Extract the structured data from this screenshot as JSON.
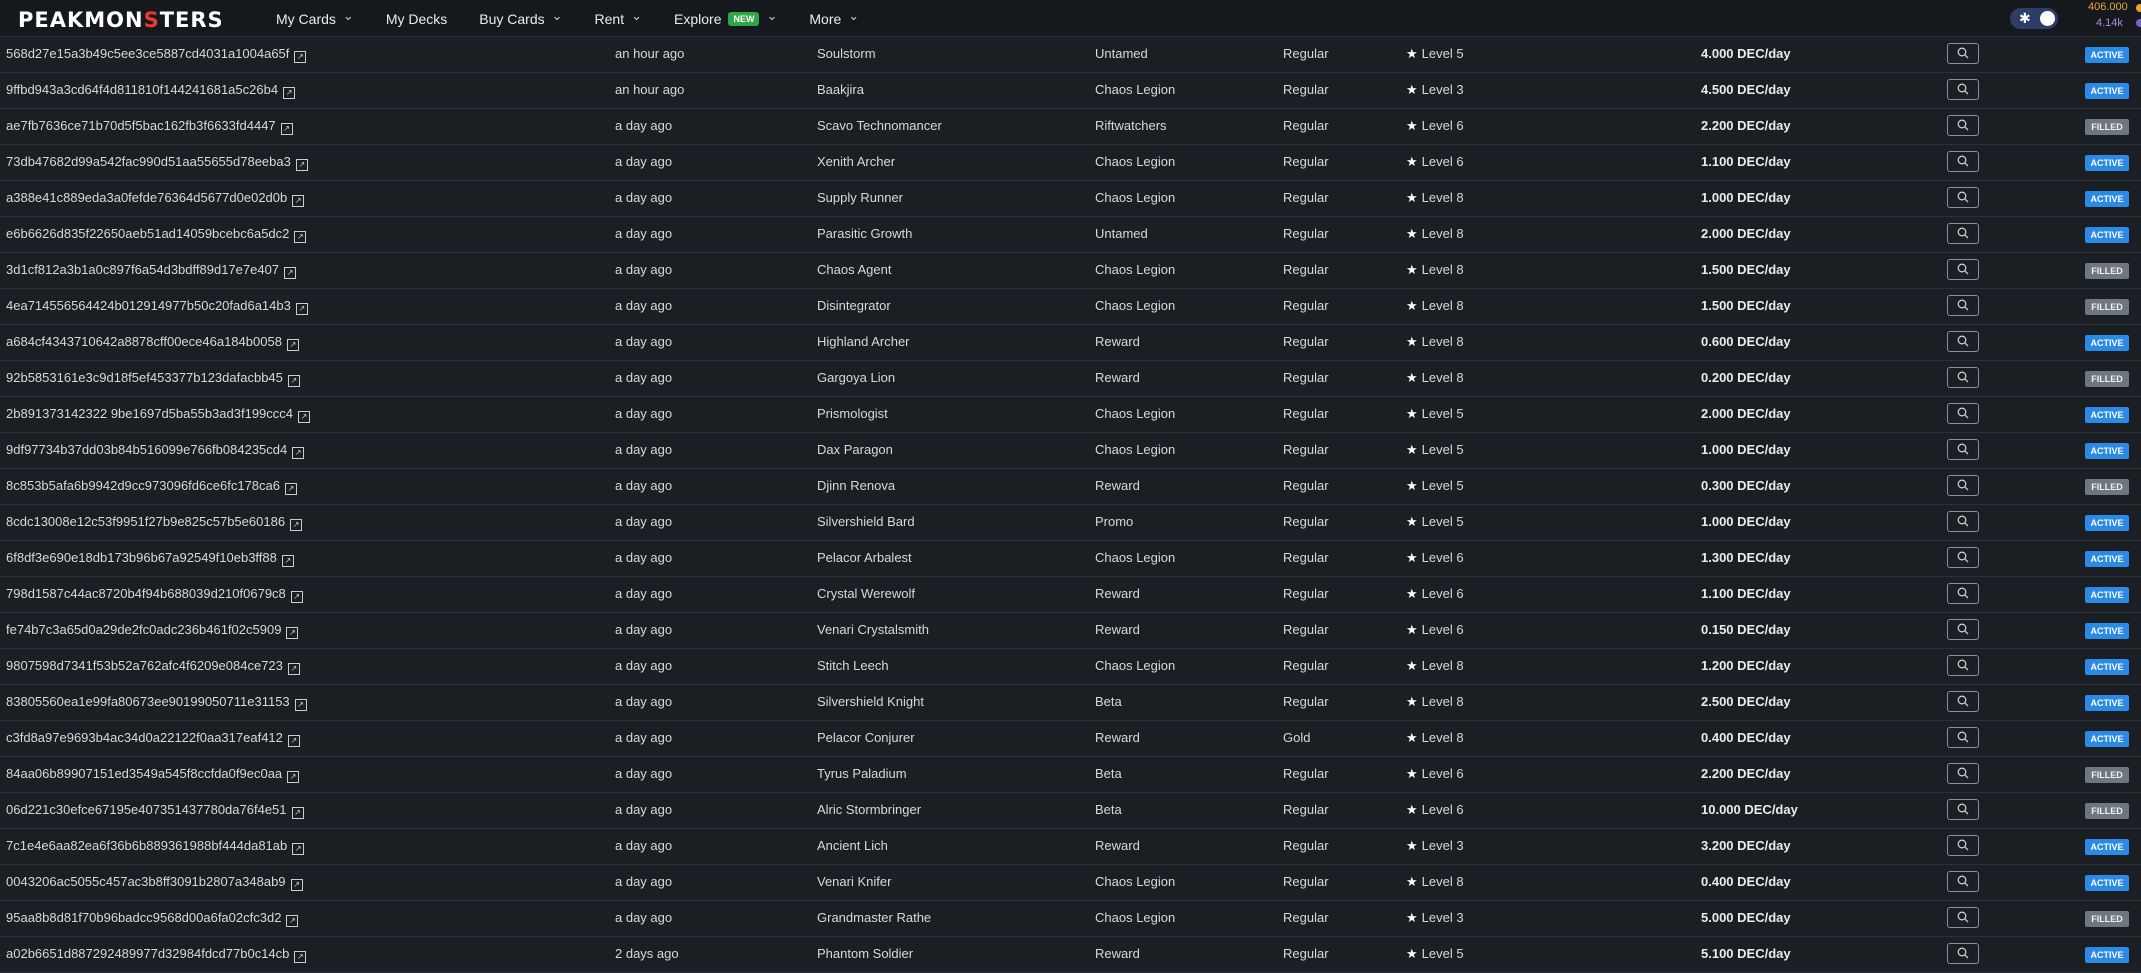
{
  "header": {
    "logo": {
      "pre": "PEAKMON",
      "mark": "S",
      "post": "TERS"
    },
    "nav": [
      {
        "label": "My Cards",
        "dropdown": true
      },
      {
        "label": "My Decks",
        "dropdown": false
      },
      {
        "label": "Buy Cards",
        "dropdown": true
      },
      {
        "label": "Rent",
        "dropdown": true
      },
      {
        "label": "Explore",
        "dropdown": true,
        "badge": "NEW"
      },
      {
        "label": "More",
        "dropdown": true
      }
    ],
    "balance_primary": "406.000",
    "balance_secondary": "4.14k",
    "colors": {
      "accent_active": "#2b8ae6",
      "filled": "#6d7780",
      "new_badge": "#2fa54a",
      "balance_primary": "#f0a33a"
    }
  },
  "rows": [
    {
      "id": "568d27e15a3b49c5ee3ce5887cd4031a1004a65f",
      "time": "an hour ago",
      "card": "Soulstorm",
      "edition": "Untamed",
      "foil": "Regular",
      "level": "Level 5",
      "price": "4.000 DEC/day",
      "status": "ACTIVE"
    },
    {
      "id": "9ffbd943a3cd64f4d811810f144241681a5c26b4",
      "time": "an hour ago",
      "card": "Baakjira",
      "edition": "Chaos Legion",
      "foil": "Regular",
      "level": "Level 3",
      "price": "4.500 DEC/day",
      "status": "ACTIVE"
    },
    {
      "id": "ae7fb7636ce71b70d5f5bac162fb3f6633fd4447",
      "time": "a day ago",
      "card": "Scavo Technomancer",
      "edition": "Riftwatchers",
      "foil": "Regular",
      "level": "Level 6",
      "price": "2.200 DEC/day",
      "status": "FILLED"
    },
    {
      "id": "73db47682d99a542fac990d51aa55655d78eeba3",
      "time": "a day ago",
      "card": "Xenith Archer",
      "edition": "Chaos Legion",
      "foil": "Regular",
      "level": "Level 6",
      "price": "1.100 DEC/day",
      "status": "ACTIVE"
    },
    {
      "id": "a388e41c889eda3a0fefde76364d5677d0e02d0b",
      "time": "a day ago",
      "card": "Supply Runner",
      "edition": "Chaos Legion",
      "foil": "Regular",
      "level": "Level 8",
      "price": "1.000 DEC/day",
      "status": "ACTIVE"
    },
    {
      "id": "e6b6626d835f22650aeb51ad14059bcebc6a5dc2",
      "time": "a day ago",
      "card": "Parasitic Growth",
      "edition": "Untamed",
      "foil": "Regular",
      "level": "Level 8",
      "price": "2.000 DEC/day",
      "status": "ACTIVE"
    },
    {
      "id": "3d1cf812a3b1a0c897f6a54d3bdff89d17e7e407",
      "time": "a day ago",
      "card": "Chaos Agent",
      "edition": "Chaos Legion",
      "foil": "Regular",
      "level": "Level 8",
      "price": "1.500 DEC/day",
      "status": "FILLED"
    },
    {
      "id": "4ea714556564424b012914977b50c20fad6a14b3",
      "time": "a day ago",
      "card": "Disintegrator",
      "edition": "Chaos Legion",
      "foil": "Regular",
      "level": "Level 8",
      "price": "1.500 DEC/day",
      "status": "FILLED"
    },
    {
      "id": "a684cf4343710642a8878cff00ece46a184b0058",
      "time": "a day ago",
      "card": "Highland Archer",
      "edition": "Reward",
      "foil": "Regular",
      "level": "Level 8",
      "price": "0.600 DEC/day",
      "status": "ACTIVE"
    },
    {
      "id": "92b5853161e3c9d18f5ef453377b123dafacbb45",
      "time": "a day ago",
      "card": "Gargoya Lion",
      "edition": "Reward",
      "foil": "Regular",
      "level": "Level 8",
      "price": "0.200 DEC/day",
      "status": "FILLED"
    },
    {
      "id": "2b891373142322 9be1697d5ba55b3ad3f199ccc4",
      "time": "a day ago",
      "card": "Prismologist",
      "edition": "Chaos Legion",
      "foil": "Regular",
      "level": "Level 5",
      "price": "2.000 DEC/day",
      "status": "ACTIVE"
    },
    {
      "id": "9df97734b37dd03b84b516099e766fb084235cd4",
      "time": "a day ago",
      "card": "Dax Paragon",
      "edition": "Chaos Legion",
      "foil": "Regular",
      "level": "Level 5",
      "price": "1.000 DEC/day",
      "status": "ACTIVE"
    },
    {
      "id": "8c853b5afa6b9942d9cc973096fd6ce6fc178ca6",
      "time": "a day ago",
      "card": "Djinn Renova",
      "edition": "Reward",
      "foil": "Regular",
      "level": "Level 5",
      "price": "0.300 DEC/day",
      "status": "FILLED"
    },
    {
      "id": "8cdc13008e12c53f9951f27b9e825c57b5e60186",
      "time": "a day ago",
      "card": "Silvershield Bard",
      "edition": "Promo",
      "foil": "Regular",
      "level": "Level 5",
      "price": "1.000 DEC/day",
      "status": "ACTIVE"
    },
    {
      "id": "6f8df3e690e18db173b96b67a92549f10eb3ff88",
      "time": "a day ago",
      "card": "Pelacor Arbalest",
      "edition": "Chaos Legion",
      "foil": "Regular",
      "level": "Level 6",
      "price": "1.300 DEC/day",
      "status": "ACTIVE"
    },
    {
      "id": "798d1587c44ac8720b4f94b688039d210f0679c8",
      "time": "a day ago",
      "card": "Crystal Werewolf",
      "edition": "Reward",
      "foil": "Regular",
      "level": "Level 6",
      "price": "1.100 DEC/day",
      "status": "ACTIVE"
    },
    {
      "id": "fe74b7c3a65d0a29de2fc0adc236b461f02c5909",
      "time": "a day ago",
      "card": "Venari Crystalsmith",
      "edition": "Reward",
      "foil": "Regular",
      "level": "Level 6",
      "price": "0.150 DEC/day",
      "status": "ACTIVE"
    },
    {
      "id": "9807598d7341f53b52a762afc4f6209e084ce723",
      "time": "a day ago",
      "card": "Stitch Leech",
      "edition": "Chaos Legion",
      "foil": "Regular",
      "level": "Level 8",
      "price": "1.200 DEC/day",
      "status": "ACTIVE"
    },
    {
      "id": "83805560ea1e99fa80673ee90199050711e31153",
      "time": "a day ago",
      "card": "Silvershield Knight",
      "edition": "Beta",
      "foil": "Regular",
      "level": "Level 8",
      "price": "2.500 DEC/day",
      "status": "ACTIVE"
    },
    {
      "id": "c3fd8a97e9693b4ac34d0a22122f0aa317eaf412",
      "time": "a day ago",
      "card": "Pelacor Conjurer",
      "edition": "Reward",
      "foil": "Gold",
      "level": "Level 8",
      "price": "0.400 DEC/day",
      "status": "ACTIVE"
    },
    {
      "id": "84aa06b89907151ed3549a545f8ccfda0f9ec0aa",
      "time": "a day ago",
      "card": "Tyrus Paladium",
      "edition": "Beta",
      "foil": "Regular",
      "level": "Level 6",
      "price": "2.200 DEC/day",
      "status": "FILLED"
    },
    {
      "id": "06d221c30efce67195e407351437780da76f4e51",
      "time": "a day ago",
      "card": "Alric Stormbringer",
      "edition": "Beta",
      "foil": "Regular",
      "level": "Level 6",
      "price": "10.000 DEC/day",
      "status": "FILLED"
    },
    {
      "id": "7c1e4e6aa82ea6f36b6b889361988bf444da81ab",
      "time": "a day ago",
      "card": "Ancient Lich",
      "edition": "Reward",
      "foil": "Regular",
      "level": "Level 3",
      "price": "3.200 DEC/day",
      "status": "ACTIVE"
    },
    {
      "id": "0043206ac5055c457ac3b8ff3091b2807a348ab9",
      "time": "a day ago",
      "card": "Venari Knifer",
      "edition": "Chaos Legion",
      "foil": "Regular",
      "level": "Level 8",
      "price": "0.400 DEC/day",
      "status": "ACTIVE"
    },
    {
      "id": "95aa8b8d81f70b96badcc9568d00a6fa02cfc3d2",
      "time": "a day ago",
      "card": "Grandmaster Rathe",
      "edition": "Chaos Legion",
      "foil": "Regular",
      "level": "Level 3",
      "price": "5.000 DEC/day",
      "status": "FILLED"
    },
    {
      "id": "a02b6651d887292489977d32984fdcd77b0c14cb",
      "time": "2 days ago",
      "card": "Phantom Soldier",
      "edition": "Reward",
      "foil": "Regular",
      "level": "Level 5",
      "price": "5.100 DEC/day",
      "status": "ACTIVE"
    }
  ]
}
